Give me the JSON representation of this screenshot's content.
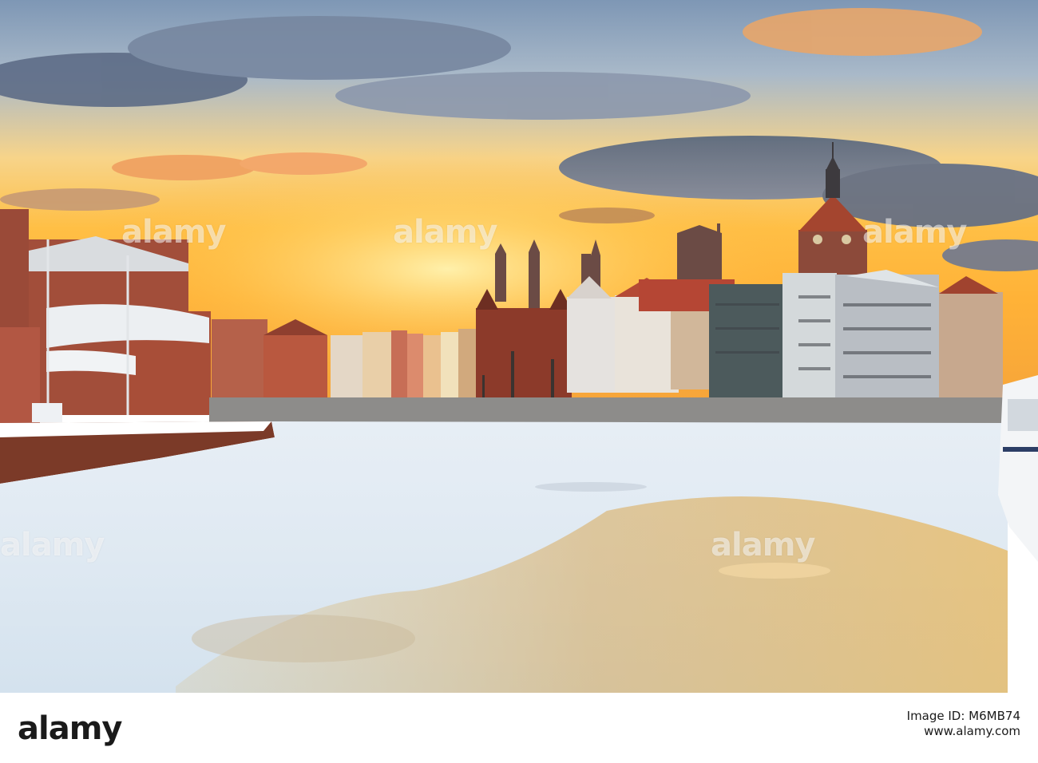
{
  "watermark": {
    "text": "alamy"
  },
  "footer": {
    "logo": "alamy",
    "image_id_label": "Image ID: M6MB74",
    "stock_prefix": "www.alamy.com",
    "stock_label": "",
    "stock_code": "M6MB74"
  },
  "colors": {
    "sky_top": "#8fa7c2",
    "sky_glow": "#ffb83c",
    "ice": "#e8f0f6",
    "brick": "#a54a34"
  }
}
